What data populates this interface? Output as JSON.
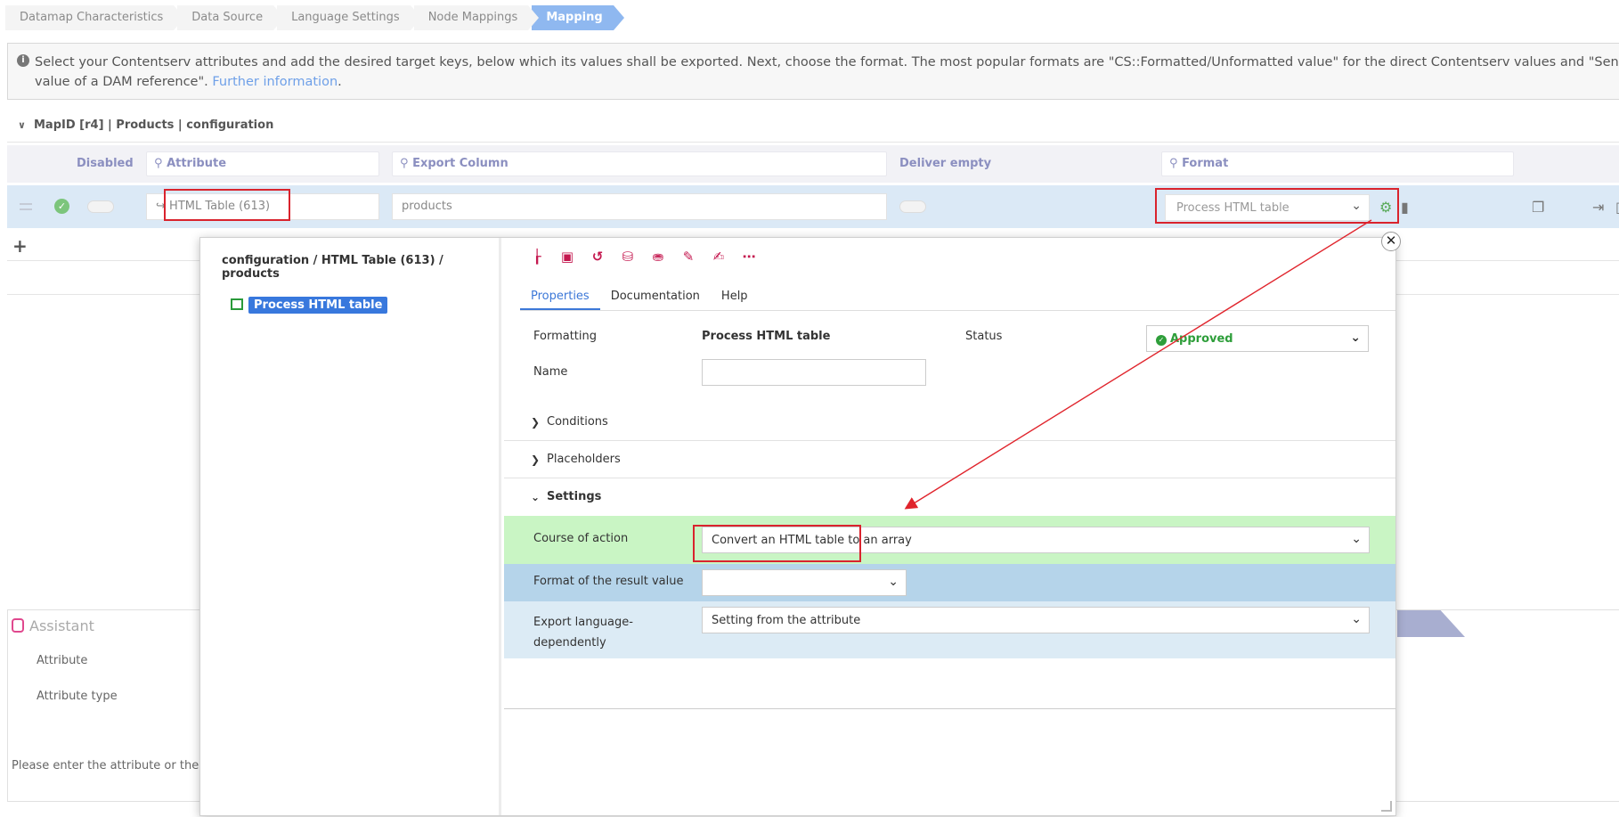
{
  "breadcrumb": [
    "Datamap Characteristics",
    "Data Source",
    "Language Settings",
    "Node Mappings",
    "Mapping"
  ],
  "info": {
    "text": "Select your Contentserv attributes and add the desired target keys, below which its values shall be exported. Next, choose the format. The most popular formats are \"CS::Formatted/Unformatted value\" for the direct Contentserv values and \"Send value of a DAM reference\". ",
    "link_line1": "Further",
    "link_line2": "information",
    "link_end": "."
  },
  "map_header": "MapID [r4] | Products | configuration",
  "columns": {
    "disabled": "Disabled",
    "attribute": "Attribute",
    "export_column": "Export Column",
    "deliver_empty": "Deliver empty",
    "format": "Format"
  },
  "row": {
    "attribute": "HTML Table (613)",
    "export_column": "products",
    "format": "Process HTML table"
  },
  "assistant": {
    "title": "Assistant",
    "attribute_label": "Attribute",
    "attribute_type_label": "Attribute type",
    "message": "Please enter the attribute or the targe"
  },
  "modal": {
    "path": "configuration / HTML Table (613) / products",
    "tree_node": "Process HTML table",
    "tabs": [
      "Properties",
      "Documentation",
      "Help"
    ],
    "formatting_label": "Formatting",
    "formatting_value": "Process HTML table",
    "status_label": "Status",
    "status_value": "Approved",
    "name_label": "Name",
    "name_value": "",
    "sections": {
      "conditions": "Conditions",
      "placeholders": "Placeholders",
      "settings": "Settings"
    },
    "settings": {
      "course_label": "Course of action",
      "course_value": "Convert an HTML table to an array",
      "result_format_label": "Format of the result value",
      "result_format_value": "",
      "export_lang_label_1": "Export language-",
      "export_lang_label_2": "dependently",
      "export_lang_value": "Setting from the attribute"
    }
  },
  "colors": {
    "accent": "#3c78d8",
    "highlight_red": "#d9232d",
    "settings_green": "#c9f5c4",
    "band_blue": "#b5d4ea",
    "band_light": "#dcebf5",
    "toolbar_icon": "#c4184f"
  }
}
